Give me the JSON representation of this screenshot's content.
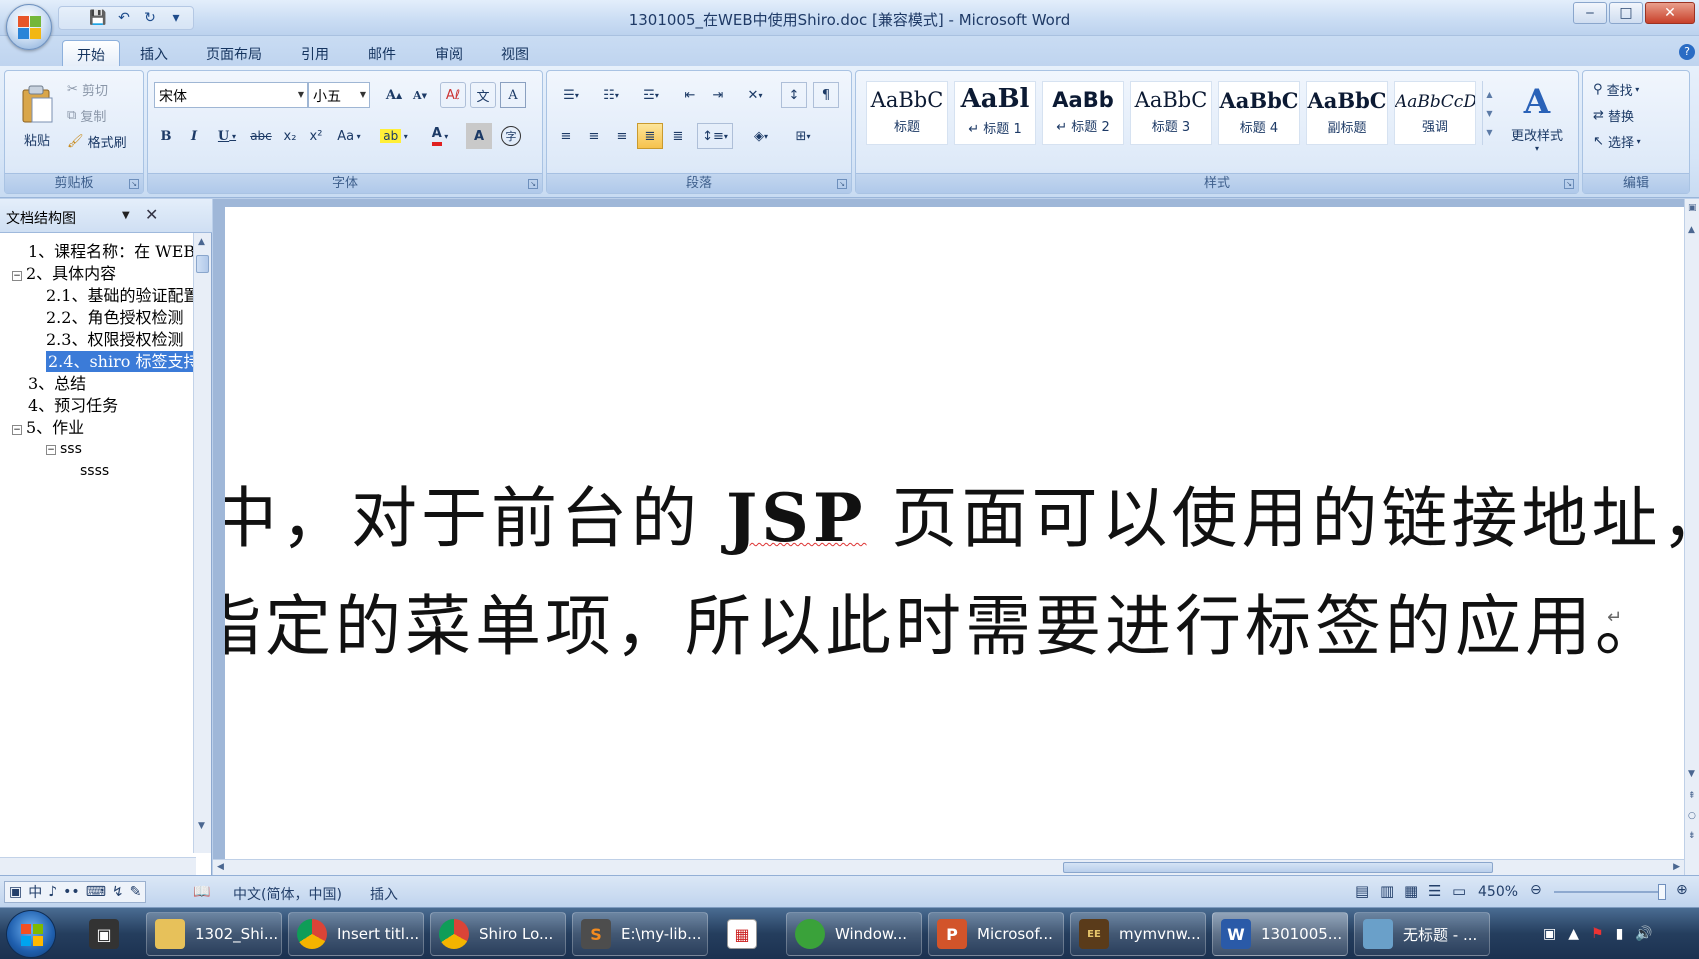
{
  "window": {
    "title": "1301005_在WEB中使用Shiro.doc [兼容模式] - Microsoft Word",
    "controls": {
      "minimize": "‒",
      "maximize": "□",
      "close": "✕"
    }
  },
  "qat": {
    "save": "💾",
    "undo": "↶",
    "redo": "↻",
    "customize": "▾"
  },
  "tabs": [
    "开始",
    "插入",
    "页面布局",
    "引用",
    "邮件",
    "审阅",
    "视图"
  ],
  "active_tab": "开始",
  "ribbon": {
    "clipboard": {
      "label": "剪贴板",
      "paste": "粘贴",
      "cut": "剪切",
      "copy": "复制",
      "format_painter": "格式刷"
    },
    "font": {
      "label": "字体",
      "font_name": "宋体",
      "font_size": "小五",
      "grow": "A",
      "shrink": "A",
      "bold": "B",
      "italic": "I",
      "underline": "U",
      "strike": "abc",
      "subscript": "x₂",
      "superscript": "x²",
      "change_case": "Aa",
      "font_color": "A",
      "char_shading": "A",
      "char_border": "A",
      "phonetic": "文"
    },
    "paragraph": {
      "label": "段落"
    },
    "styles": {
      "label": "样式",
      "items": [
        {
          "sample": "AaBbC",
          "name": "标题"
        },
        {
          "sample": "AaBl",
          "name": "↵ 标题 1"
        },
        {
          "sample": "AaBb",
          "name": "↵ 标题 2"
        },
        {
          "sample": "AaBbC",
          "name": "标题 3"
        },
        {
          "sample": "AaBbC",
          "name": "标题 4"
        },
        {
          "sample": "AaBbC",
          "name": "副标题"
        },
        {
          "sample": "AaBbCcD",
          "name": "强调"
        }
      ],
      "change_styles": "更改样式"
    },
    "editing": {
      "label": "编辑",
      "find": "查找",
      "replace": "替换",
      "select": "选择"
    }
  },
  "doc_map": {
    "title": "文档结构图",
    "items": [
      {
        "text": "1、课程名称：在 WEB",
        "toggle": ""
      },
      {
        "text": "2、具体内容",
        "toggle": "⊟"
      },
      {
        "text": "2.1、基础的验证配置",
        "toggle": ""
      },
      {
        "text": "2.2、角色授权检测",
        "toggle": ""
      },
      {
        "text": "2.3、权限授权检测",
        "toggle": ""
      },
      {
        "text": "2.4、shiro 标签支持",
        "toggle": ""
      },
      {
        "text": "3、总结",
        "toggle": ""
      },
      {
        "text": "4、预习任务",
        "toggle": ""
      },
      {
        "text": "5、作业",
        "toggle": "⊟"
      },
      {
        "text": "sss",
        "toggle": "⊟"
      },
      {
        "text": "ssss",
        "toggle": ""
      }
    ]
  },
  "document": {
    "line1_a": "中，对于前台的 ",
    "line1_jsp": "JSP",
    "line1_b": " 页面可以使用的链接地址，实",
    "line2": "指定的菜单项，所以此时需要进行标签的应用。",
    "para_mark": "↵"
  },
  "status": {
    "language": "中文(简体，中国)",
    "mode": "插入",
    "zoom": "450%",
    "ime": [
      "中",
      "♪",
      "••",
      "⌨",
      "↯",
      "✎"
    ]
  },
  "taskbar": {
    "tasks": [
      {
        "label": "1302_Shi...",
        "icon": "folder-icon",
        "color": "#e7c15a"
      },
      {
        "label": "Insert titl...",
        "icon": "chrome-icon",
        "color": "#dd4b39"
      },
      {
        "label": "Shiro Lo...",
        "icon": "chrome-icon",
        "color": "#dd4b39"
      },
      {
        "label": "E:\\my-lib...",
        "icon": "sublime-icon",
        "color": "#4d4d4d"
      },
      {
        "label": "Window...",
        "icon": "frog-icon",
        "color": "#3aa23a"
      },
      {
        "label": "Microsof...",
        "icon": "powerpoint-icon",
        "color": "#d2542a"
      },
      {
        "label": "mymvnw...",
        "icon": "javaee-icon",
        "color": "#5a3b1a"
      },
      {
        "label": "1301005...",
        "icon": "word-icon",
        "color": "#2a5aa8"
      },
      {
        "label": "无标题 - ...",
        "icon": "notepad-icon",
        "color": "#6aa0c9"
      }
    ]
  }
}
